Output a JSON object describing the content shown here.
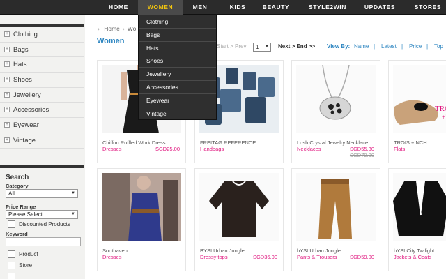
{
  "nav": {
    "items": [
      "HOME",
      "WOMEN",
      "MEN",
      "KIDS",
      "BEAUTY",
      "STYLE2WIN",
      "UPDATES",
      "STORES"
    ],
    "active_index": 1,
    "active_color": "#f1c40f"
  },
  "dropdown": {
    "items": [
      "Clothing",
      "Bags",
      "Hats",
      "Shoes",
      "Jewellery",
      "Accessories",
      "Eyewear",
      "Vintage"
    ]
  },
  "sidebar": {
    "categories": [
      "Clothing",
      "Bags",
      "Hats",
      "Shoes",
      "Jewellery",
      "Accessories",
      "Eyewear",
      "Vintage"
    ],
    "search": {
      "title": "Search",
      "category_label": "Category",
      "category_value": "All",
      "price_label": "Price Range",
      "price_value": "Please Select",
      "discounted_label": "Discounted Products",
      "keyword_label": "Keyword",
      "keyword_value": "",
      "product_label": "Product",
      "store_label": "Store"
    }
  },
  "breadcrumb": {
    "home": "Home",
    "current": "Wo"
  },
  "page_title": "Women",
  "pager": {
    "start": "Start",
    "prev": "Prev",
    "page": "1",
    "next": "Next",
    "end": "End",
    "view_by_label": "View By:",
    "view_options": [
      "Name",
      "Latest",
      "Price",
      "Top"
    ]
  },
  "products": [
    {
      "name": "Chiffon Ruffled Work Dress",
      "category": "Dresses",
      "price": "SGD25.00",
      "old_price": ""
    },
    {
      "name": "FREITAG REFERENCE",
      "category": "Handbags",
      "price": "",
      "old_price": ""
    },
    {
      "name": "Lush Crystal Jewelry Necklace",
      "category": "Necklaces",
      "price": "SGD55.30",
      "old_price": "SGD79.00"
    },
    {
      "name": "TROIS +INCH",
      "category": "Flats",
      "price": "",
      "old_price": "",
      "image_text": [
        "TROIS",
        "+inch"
      ]
    },
    {
      "name": "Southaven",
      "category": "Dresses",
      "price": "",
      "old_price": ""
    },
    {
      "name": "BYSI Urban Jungle",
      "category": "Dressy tops",
      "price": "SGD36.00",
      "old_price": ""
    },
    {
      "name": "bYSI Urban Jungle",
      "category": "Pants & Trousers",
      "price": "SGD59.00",
      "old_price": ""
    },
    {
      "name": "bYSI City Twilight",
      "category": "Jackets & Coats",
      "price": "",
      "old_price": ""
    }
  ],
  "colors": {
    "nav_bg": "#2b2b2b",
    "link_blue": "#2e86c1",
    "category_pink": "#e0177f",
    "sidebar_bg": "#f2f2f0"
  }
}
